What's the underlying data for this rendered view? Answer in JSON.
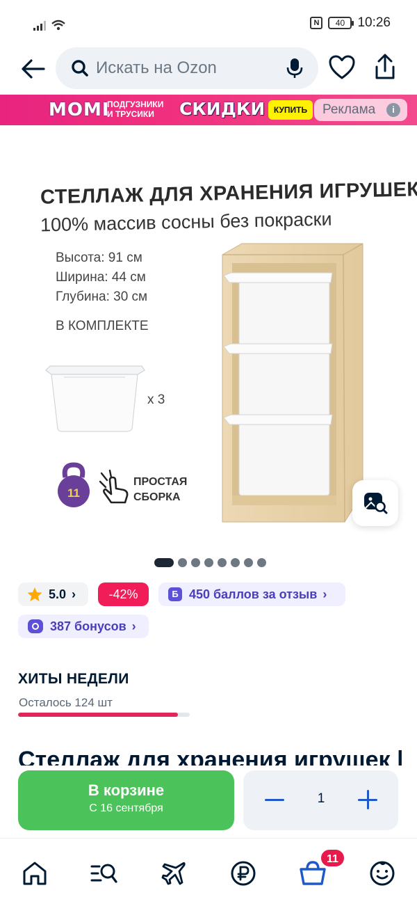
{
  "status_bar": {
    "time": "10:26",
    "battery": "40",
    "nfc": "N"
  },
  "header": {
    "search_placeholder": "Искать на Ozon"
  },
  "banner": {
    "brand": "MOMI",
    "brand_sub_line1": "подгузники",
    "brand_sub_line2": "и трусики",
    "sale": "СКИДКИ",
    "buy": "КУПИТЬ",
    "ad_label": "Реклама"
  },
  "product_image": {
    "title": "СТЕЛЛАЖ ДЛЯ ХРАНЕНИЯ ИГРУШЕК",
    "subtitle": "100% массив сосны без покраски",
    "dims": [
      "Высота: 91 см",
      "Ширина: 44 см",
      "Глубина: 30 см"
    ],
    "set_label": "В КОМПЛЕКТЕ",
    "qty_label": "x 3",
    "weight_badge": "11",
    "easy_line1": "ПРОСТАЯ",
    "easy_line2": "СБОРКА"
  },
  "gallery": {
    "count": 8,
    "active": 0
  },
  "chips": {
    "rating": "5.0",
    "discount": "-42%",
    "points_icon": "Б",
    "points": "450 баллов за отзыв",
    "bonuses": "387 бонусов"
  },
  "hits": {
    "title": "ХИТЫ НЕДЕЛИ",
    "remaining": "Осталось 124 шт",
    "progress": 0.93
  },
  "product_title": "Стеллаж для хранения игрушек |",
  "action_bar": {
    "cart_label": "В корзине",
    "delivery": "С 16 сентября",
    "quantity": "1"
  },
  "bottom_nav": {
    "items": [
      "home",
      "catalog",
      "travel",
      "finance",
      "cart",
      "profile"
    ],
    "cart_badge": "11"
  },
  "colors": {
    "accent_blue": "#1f58c7",
    "cart_green": "#4cc25a",
    "discount_red": "#f01d58",
    "banner_pink": "#e8247f",
    "bonus_purple": "#5b50d6"
  }
}
